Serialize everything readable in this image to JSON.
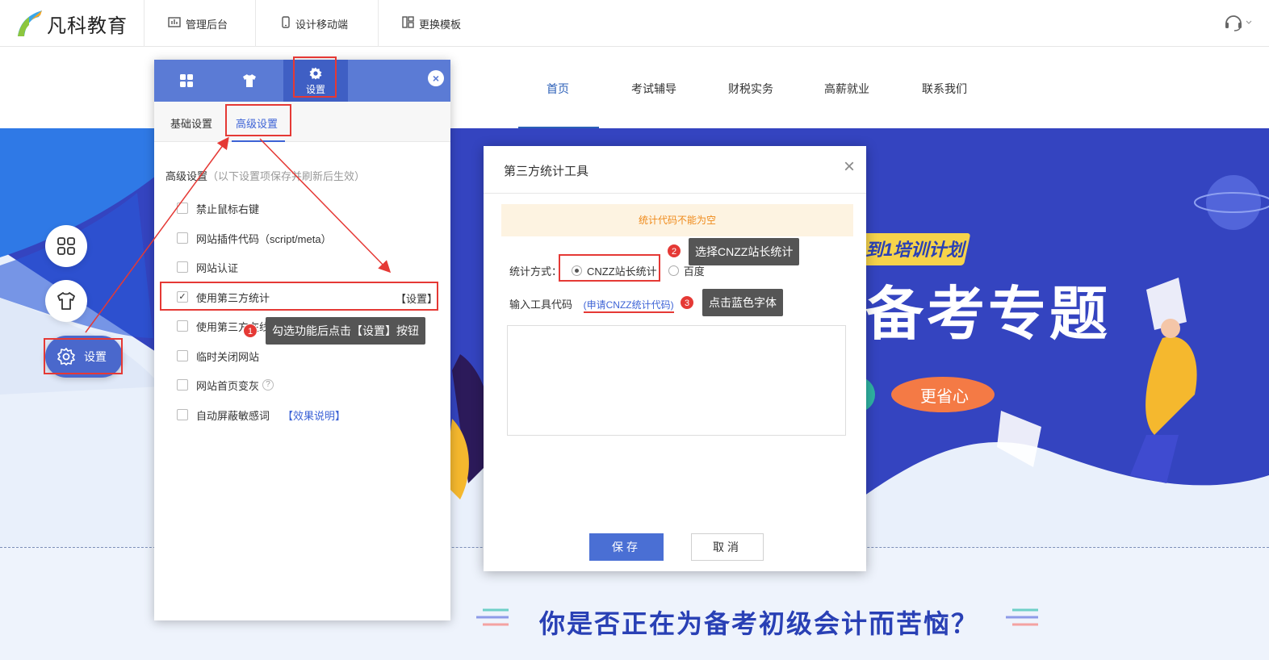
{
  "topbar": {
    "brand": "凡科教育",
    "nav": [
      {
        "label": "管理后台",
        "icon": "dashboard-icon"
      },
      {
        "label": "设计移动端",
        "icon": "mobile-icon"
      },
      {
        "label": "更换模板",
        "icon": "template-icon"
      }
    ],
    "support_icon": "headset-icon"
  },
  "site_nav": {
    "items": [
      "首页",
      "考试辅导",
      "财税实务",
      "高薪就业",
      "联系我们"
    ],
    "active": "首页"
  },
  "banner": {
    "tagline": "到1培训计划",
    "headline": "备考专题",
    "pill": "更省心"
  },
  "below_banner": {
    "question": "你是否正在为备考初级会计而苦恼？"
  },
  "float_menu": {
    "items": [
      {
        "icon": "grid-icon"
      },
      {
        "icon": "shirt-icon"
      }
    ],
    "settings_label": "设置"
  },
  "settings_panel": {
    "tabs": [
      {
        "icon": "grid-icon",
        "label": ""
      },
      {
        "icon": "shirt-icon",
        "label": ""
      },
      {
        "icon": "gear-icon",
        "label": "设置"
      }
    ],
    "subtabs": [
      "基础设置",
      "高级设置"
    ],
    "active_subtab": "高级设置",
    "section_title": "高级设置",
    "section_hint": "（以下设置项保存并刷新后生效）",
    "options": [
      {
        "label": "禁止鼠标右键",
        "checked": false
      },
      {
        "label": "网站插件代码（script/meta）",
        "checked": false
      },
      {
        "label": "网站认证",
        "checked": false
      },
      {
        "label": "使用第三方统计",
        "checked": true,
        "action": "【设置】"
      },
      {
        "label": "使用第三方在线客服",
        "checked": false
      },
      {
        "label": "临时关闭网站",
        "checked": false
      },
      {
        "label": "网站首页变灰",
        "checked": false,
        "help": "?"
      },
      {
        "label": "自动屏蔽敏感词",
        "checked": false,
        "link": "【效果说明】"
      }
    ]
  },
  "callouts": [
    {
      "num": "1",
      "text": "勾选功能后点击【设置】按钮"
    },
    {
      "num": "2",
      "text": "选择CNZZ站长统计"
    },
    {
      "num": "3",
      "text": "点击蓝色字体"
    }
  ],
  "dialog": {
    "title": "第三方统计工具",
    "close": "×",
    "warning": "统计代码不能为空",
    "method_label": "统计方式：",
    "methods": [
      {
        "label": "CNZZ站长统计",
        "selected": true
      },
      {
        "label": "百度",
        "selected": false
      }
    ],
    "tool_code_label": "输入工具代码",
    "apply_link": "(申请CNZZ统计代码)",
    "code_value": "",
    "save_label": "保存",
    "cancel_label": "取消"
  },
  "colors": {
    "primary": "#4a68cc",
    "panel_tab": "#5b7bd5",
    "highlight_red": "#e53935",
    "warn_bg": "#fdf3e1",
    "warn_text": "#ef8a1a",
    "banner_blue": "#2f3fb8"
  }
}
